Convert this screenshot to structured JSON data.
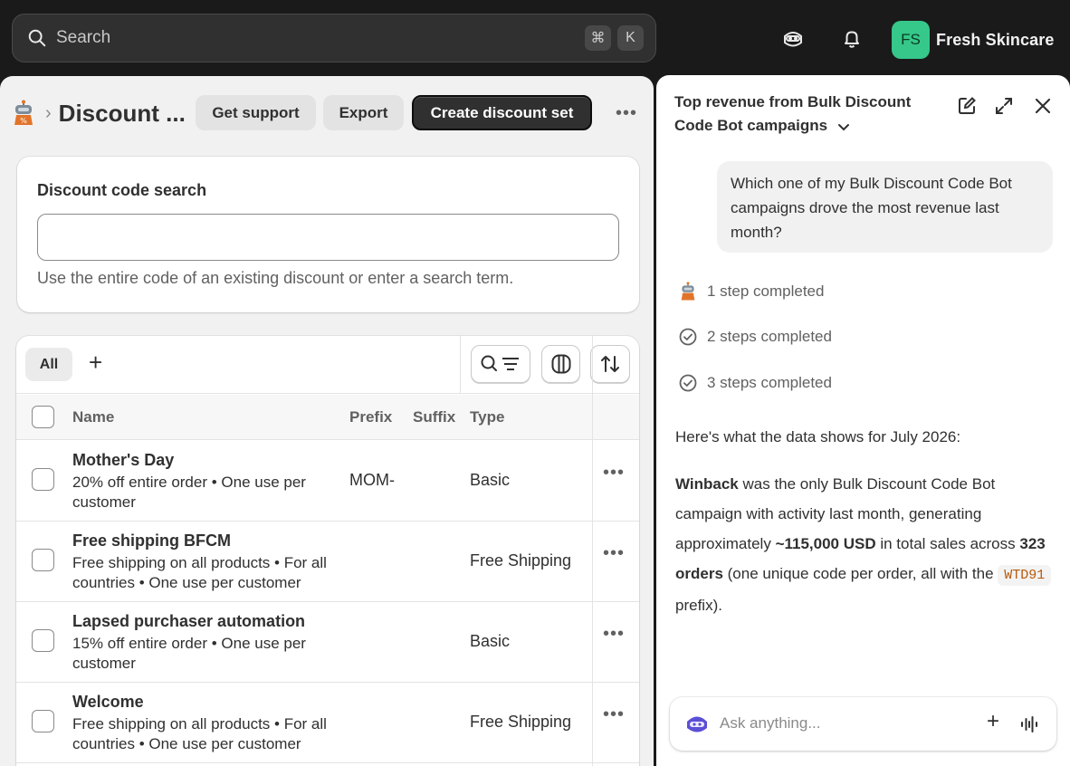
{
  "topbar": {
    "search_placeholder": "Search",
    "shortcut_keys": [
      "⌘",
      "K"
    ],
    "store_initials": "FS",
    "store_name": "Fresh Skincare"
  },
  "header": {
    "page_title": "Discount ...",
    "get_support_label": "Get support",
    "export_label": "Export",
    "create_label": "Create discount set"
  },
  "search_card": {
    "title": "Discount code search",
    "input_value": "",
    "help_text": "Use the entire code of an existing discount or enter a search term."
  },
  "table": {
    "tab_all": "All",
    "columns": {
      "name": "Name",
      "prefix": "Prefix",
      "suffix": "Suffix",
      "type": "Type"
    },
    "rows": [
      {
        "name": "Mother's Day",
        "desc": "20% off entire order • One use per customer",
        "prefix": "MOM-",
        "suffix": "",
        "type": "Basic"
      },
      {
        "name": "Free shipping BFCM",
        "desc": "Free shipping on all products • For all countries • One use per customer",
        "prefix": "",
        "suffix": "",
        "type": "Free Shipping"
      },
      {
        "name": "Lapsed purchaser automation",
        "desc": "15% off entire order • One use per customer",
        "prefix": "",
        "suffix": "",
        "type": "Basic"
      },
      {
        "name": "Welcome",
        "desc": "Free shipping on all products • For all countries • One use per customer",
        "prefix": "",
        "suffix": "",
        "type": "Free Shipping"
      }
    ]
  },
  "assistant": {
    "title": "Top revenue from Bulk Discount Code Bot campaigns",
    "user_message": "Which one of my Bulk Discount Code Bot campaigns drove the most revenue last month?",
    "steps": [
      "1 step completed",
      "2 steps completed",
      "3 steps completed"
    ],
    "intro": "Here's what the data shows for July 2026:",
    "answer": {
      "campaign": "Winback",
      "t1": " was the only Bulk Discount Code Bot campaign with activity last month, generating approximately ",
      "revenue": "~115,000 USD",
      "t2": " in total sales across ",
      "orders": "323 orders",
      "t3": " (one unique code per order, all with the ",
      "prefix_code": "WTD91",
      "t4": " prefix)."
    },
    "ask_placeholder": "Ask anything..."
  },
  "colors": {
    "accent_dark": "#303030",
    "avatar_green": "#36c88a",
    "code_text": "#b85a0c"
  }
}
